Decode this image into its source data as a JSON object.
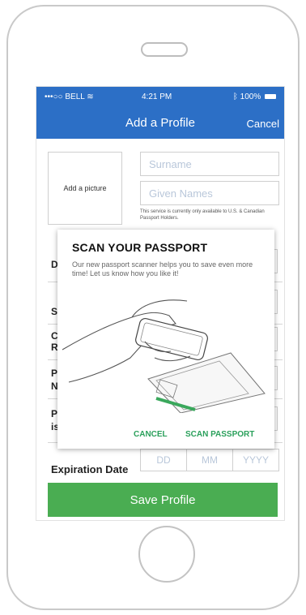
{
  "status_bar": {
    "carrier": "•••○○ BELL",
    "time": "4:21 PM",
    "battery": "100%"
  },
  "header": {
    "title": "Add a Profile",
    "cancel_label": "Cancel"
  },
  "form": {
    "add_picture_label": "Add a picture",
    "surname_placeholder": "Surname",
    "given_names_placeholder": "Given Names",
    "notice": "This service is currently only available to U.S. & Canadian Passport Holders.",
    "partial_labels": [
      "D",
      "S",
      "C",
      "R",
      "P",
      "N",
      "P",
      "is"
    ],
    "expiration_label": "Expiration Date",
    "expiration_placeholders": [
      "DD",
      "MM",
      "YYYY"
    ],
    "save_label": "Save Profile"
  },
  "modal": {
    "title": "SCAN YOUR PASSPORT",
    "body": "Our new passport scanner helps you to save even more time! Let us know how you like it!",
    "cancel_label": "CANCEL",
    "scan_label": "SCAN PASSPORT"
  },
  "colors": {
    "header_blue": "#2c6fc6",
    "save_green": "#4aad52",
    "action_green": "#2aa05b"
  },
  "icons": [
    "wifi-icon",
    "bluetooth-icon",
    "battery-icon"
  ]
}
